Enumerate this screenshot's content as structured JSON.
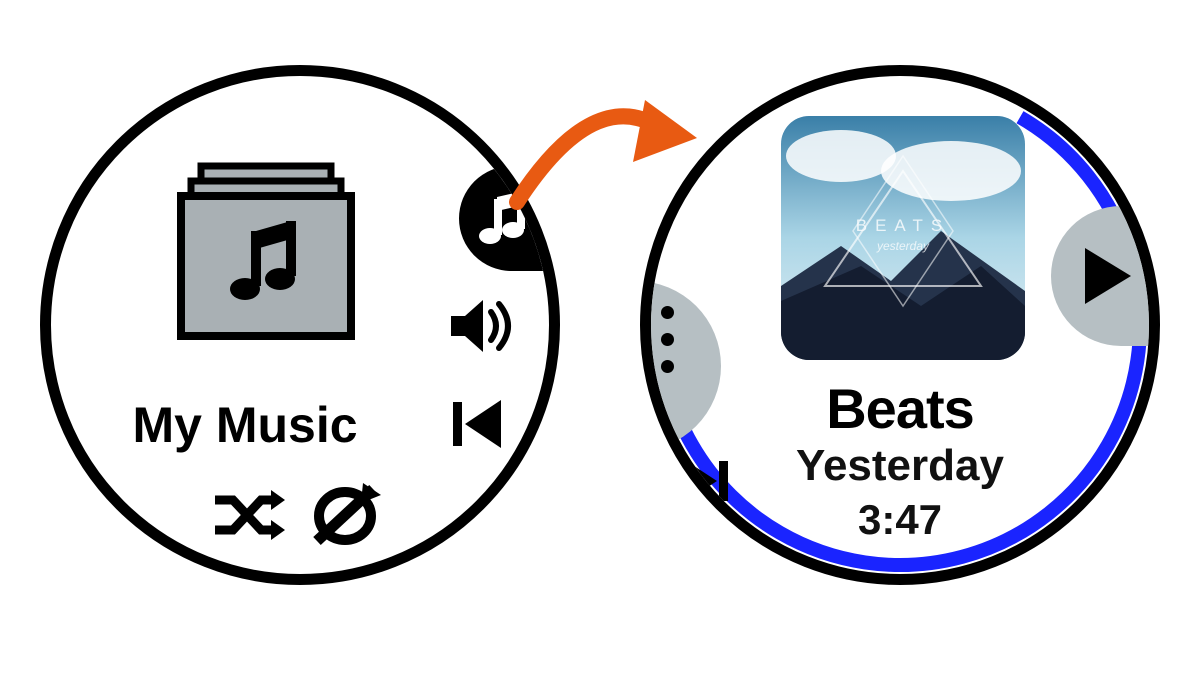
{
  "left_screen": {
    "title": "My Music",
    "icons": {
      "folder": "music-folder-icon",
      "source_pill": "music-source-icon",
      "speaker": "speaker-icon",
      "previous": "previous-track-icon",
      "shuffle": "shuffle-icon",
      "repeat_off": "repeat-off-icon"
    }
  },
  "right_screen": {
    "track_title": "Beats",
    "track_subtitle": "Yesterday",
    "track_time": "3:47",
    "album_art_label": "BEATS",
    "album_art_sub": "yesterday",
    "progress_color": "#1a24ff",
    "icons": {
      "more": "more-icon",
      "next": "next-track-icon",
      "play": "play-icon"
    }
  },
  "arrow": {
    "color": "#e85a12"
  }
}
